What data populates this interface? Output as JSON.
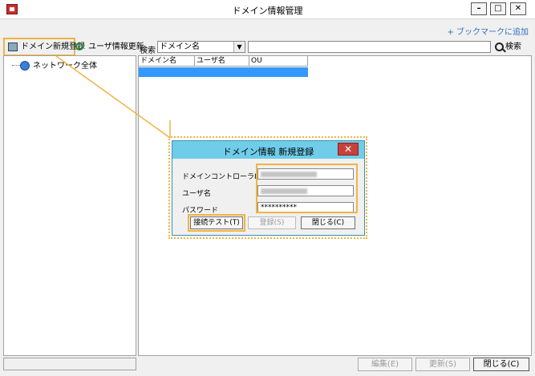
{
  "window": {
    "title": "ドメイン情報管理",
    "controls": {
      "minimize": "–",
      "maximize": "□",
      "close": "✕"
    }
  },
  "header": {
    "bookmark_link": "+ ブックマークに追加"
  },
  "toolbar": {
    "new_domain_label": "ドメイン新規登録",
    "refresh_users_label": "ユーザ情報更新"
  },
  "tree": {
    "root_label": "ネットワーク全体"
  },
  "search": {
    "label": "検索",
    "field_select": "ドメイン名",
    "query": "",
    "button_label": "検索"
  },
  "grid": {
    "columns": [
      "ドメイン名",
      "ユーザ名",
      "OU"
    ]
  },
  "footer": {
    "edit_label": "編集(E)",
    "update_label": "更新(S)",
    "close_label": "閉じる(C)"
  },
  "dialog": {
    "title": "ドメイン情報 新規登録",
    "close_icon": "✕",
    "fields": {
      "dc_ip_label": "ドメインコントローラIPアドレス",
      "user_label": "ユーザ名",
      "password_label": "パスワード",
      "password_value": "**********"
    },
    "buttons": {
      "test_label": "接続テスト(T)",
      "register_label": "登録(S)",
      "close_label": "閉じる(C)"
    }
  },
  "colors": {
    "highlight": "#f0b443",
    "dialog_title_bg": "#6fcdea",
    "selection": "#3399ff",
    "link": "#2f6fbf",
    "close_red": "#c9403a"
  }
}
